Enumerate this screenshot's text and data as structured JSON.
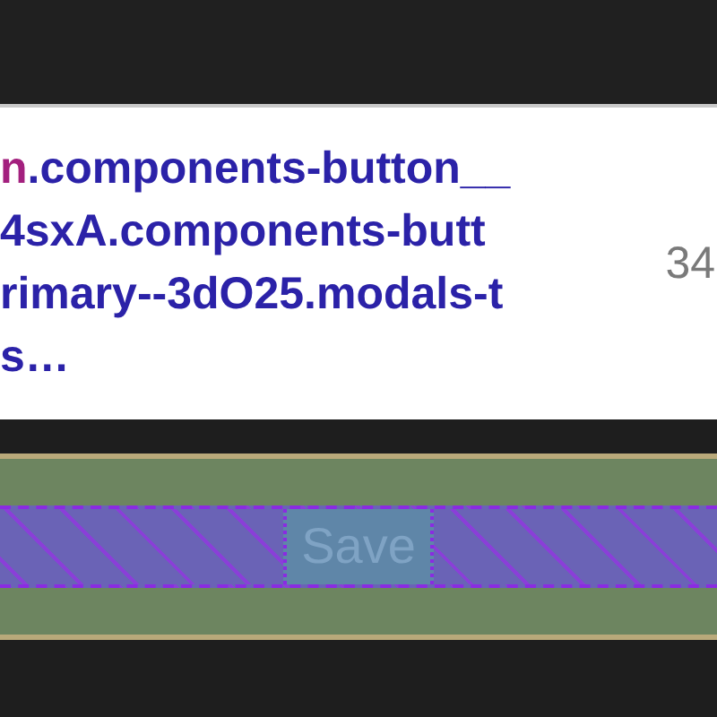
{
  "tooltip": {
    "tag": "n",
    "selector_lines": [
      ".components-button__",
      "4sxA.components-butt",
      "rimary--3dO25.modals-t",
      "s…"
    ],
    "size": "34"
  },
  "element": {
    "label": "Save"
  }
}
